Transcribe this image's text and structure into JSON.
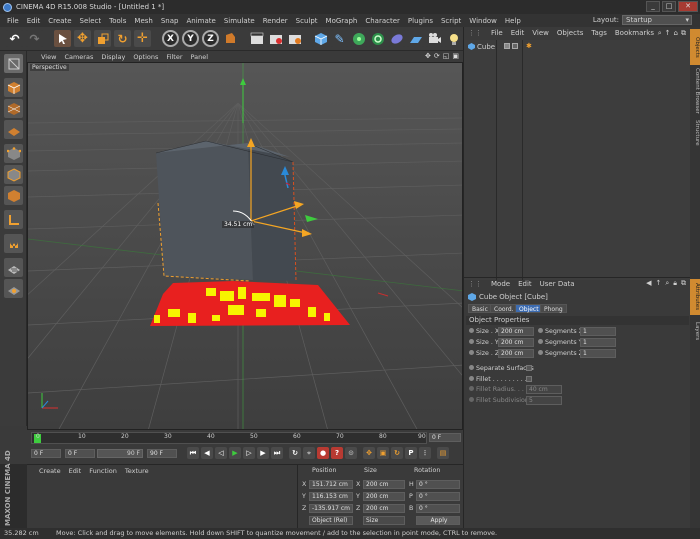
{
  "app": {
    "title": "CINEMA 4D R15.008 Studio - [Untitled 1 *]",
    "window_buttons": [
      "_",
      "□",
      "✕"
    ]
  },
  "menubar": {
    "items": [
      "File",
      "Edit",
      "Create",
      "Select",
      "Tools",
      "Mesh",
      "Snap",
      "Animate",
      "Simulate",
      "Render",
      "Sculpt",
      "MoGraph",
      "Character",
      "Plugins",
      "Script",
      "Window",
      "Help"
    ],
    "layout_label": "Layout:",
    "layout_value": "Startup"
  },
  "toolbar": {
    "axis_x": "X",
    "axis_y": "Y",
    "axis_z": "Z"
  },
  "viewport": {
    "menu": [
      "View",
      "Cameras",
      "Display",
      "Options",
      "Filter",
      "Panel"
    ],
    "camera_label": "Perspective",
    "measure_label": "34.51 cm",
    "nav_icons": [
      "✥",
      "⟳",
      "◱",
      "▣"
    ]
  },
  "timeline": {
    "ticks": [
      "0",
      "10",
      "20",
      "30",
      "40",
      "50",
      "60",
      "70",
      "80",
      "90"
    ],
    "end_frame_field": "0 F",
    "current_frame": "0 F",
    "min_frame": "0 F",
    "max_frame_a": "90 F",
    "max_frame_b": "90 F"
  },
  "material_manager": {
    "menu": [
      "Create",
      "Edit",
      "Function",
      "Texture"
    ]
  },
  "coordinates": {
    "headers": [
      "Position",
      "Size",
      "Rotation"
    ],
    "rows": [
      {
        "axis": "X",
        "pos": "151.712 cm",
        "size_axis": "X",
        "size": "200 cm",
        "rot_axis": "H",
        "rot": "0 °"
      },
      {
        "axis": "Y",
        "pos": "116.153 cm",
        "size_axis": "Y",
        "size": "200 cm",
        "rot_axis": "P",
        "rot": "0 °"
      },
      {
        "axis": "Z",
        "pos": "-135.917 cm",
        "size_axis": "Z",
        "size": "200 cm",
        "rot_axis": "B",
        "rot": "0 °"
      }
    ],
    "mode_select": "Object (Rel)",
    "size_select": "Size",
    "apply_label": "Apply"
  },
  "object_manager": {
    "menu": [
      "File",
      "Edit",
      "View",
      "Objects",
      "Tags",
      "Bookmarks"
    ],
    "objects": [
      {
        "name": "Cube"
      }
    ]
  },
  "attribute_manager": {
    "menu": [
      "Mode",
      "Edit",
      "User Data"
    ],
    "object_title": "Cube Object [Cube]",
    "tabs": [
      "Basic",
      "Coord.",
      "Object",
      "Phong"
    ],
    "active_tab": "Object",
    "section": "Object Properties",
    "size_x_label": "Size . X",
    "size_x": "200 cm",
    "size_y_label": "Size . Y",
    "size_y": "200 cm",
    "size_z_label": "Size . Z",
    "size_z": "200 cm",
    "seg_x_label": "Segments X",
    "seg_x": "1",
    "seg_y_label": "Segments Y",
    "seg_y": "1",
    "seg_z_label": "Segments Z",
    "seg_z": "1",
    "separate_surfaces": "Separate Surfaces",
    "fillet": "Fillet . . . . . . . . . .",
    "fillet_radius_label": "Fillet Radius. . . . .",
    "fillet_radius": "40 cm",
    "fillet_subdiv_label": "Fillet Subdivision",
    "fillet_subdiv": "5"
  },
  "side_tabs": [
    "Objects",
    "Content Browser",
    "Structure",
    "Attributes",
    "Layers"
  ],
  "status": {
    "value": "35.282 cm",
    "message": "Move: Click and drag to move elements. Hold down SHIFT to quantize movement / add to the selection in point mode, CTRL to remove."
  },
  "maxon_brand": "MAXON CINEMA 4D",
  "colors": {
    "accent": "#3c6bb0",
    "cube": "#4f565f",
    "axis_y": "#f5a623",
    "axis_x": "#e06020",
    "axis_z": "#2a8ad8",
    "grid_green": "#3ecc3e"
  }
}
